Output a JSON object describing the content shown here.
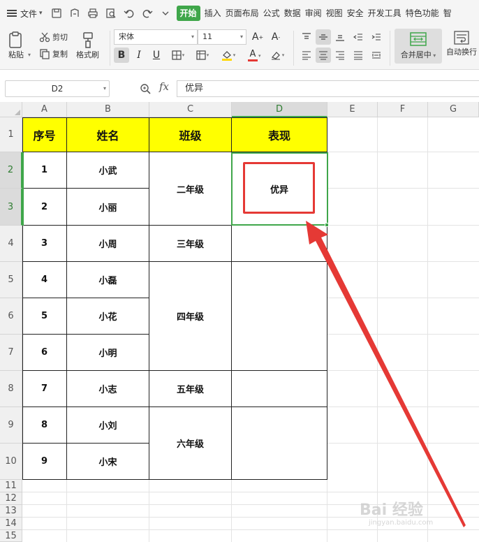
{
  "menubar": {
    "file_label": "文件",
    "tabs": [
      "开始",
      "插入",
      "页面布局",
      "公式",
      "数据",
      "审阅",
      "视图",
      "安全",
      "开发工具",
      "特色功能",
      "智"
    ],
    "active_tab": "开始",
    "accent": "#3fa64a"
  },
  "ribbon": {
    "paste_label": "粘贴",
    "cut_label": "剪切",
    "copy_label": "复制",
    "format_painter_label": "格式刷",
    "font_name": "宋体",
    "font_size": "11",
    "merge_label": "合并居中",
    "wrap_label": "自动换行",
    "font_color": "#e53935",
    "fill_color": "#ffd700"
  },
  "formula_bar": {
    "cell_ref": "D2",
    "fx_label": "fx",
    "content": "优异"
  },
  "columns": [
    "A",
    "B",
    "C",
    "D",
    "E",
    "F",
    "G"
  ],
  "selected_column": "D",
  "rows": [
    "1",
    "2",
    "3",
    "4",
    "5",
    "6",
    "7",
    "8",
    "9",
    "10",
    "11",
    "12",
    "13",
    "14",
    "15"
  ],
  "selected_rows": [
    "2",
    "3"
  ],
  "table": {
    "header": {
      "seq": "序号",
      "name": "姓名",
      "class": "班级",
      "perf": "表现"
    },
    "header_bg": "#ffff00",
    "records": [
      {
        "seq": "1",
        "name": "小武"
      },
      {
        "seq": "2",
        "name": "小丽"
      },
      {
        "seq": "3",
        "name": "小周"
      },
      {
        "seq": "4",
        "name": "小磊"
      },
      {
        "seq": "5",
        "name": "小花"
      },
      {
        "seq": "6",
        "name": "小明"
      },
      {
        "seq": "7",
        "name": "小志"
      },
      {
        "seq": "8",
        "name": "小刘"
      },
      {
        "seq": "9",
        "name": "小宋"
      }
    ],
    "classes": [
      "二年级",
      "三年级",
      "四年级",
      "五年级",
      "六年级"
    ],
    "performance": [
      "优异"
    ]
  },
  "annotation": {
    "highlight_color": "#e53935"
  },
  "watermark": {
    "text": "Bai 经验",
    "sub": "jingyan.baidu.com"
  }
}
